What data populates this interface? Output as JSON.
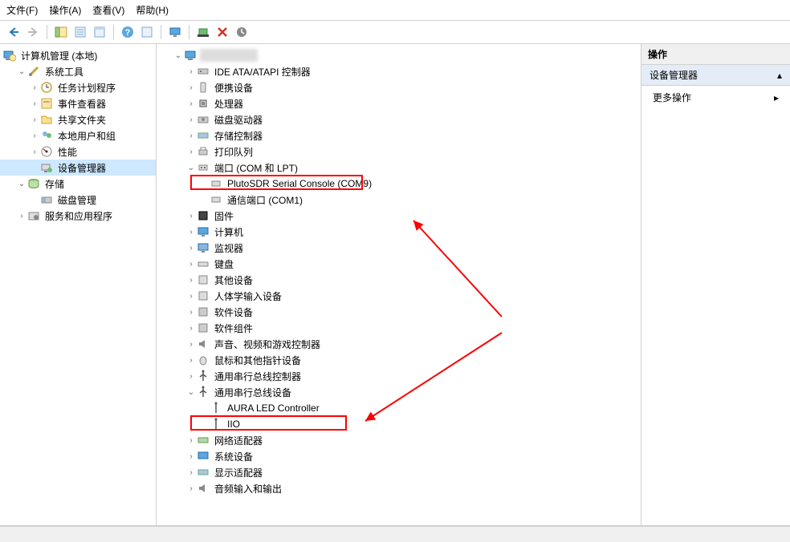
{
  "menu": {
    "file": "文件(F)",
    "action": "操作(A)",
    "view": "查看(V)",
    "help": "帮助(H)"
  },
  "left_tree": {
    "root": "计算机管理 (本地)",
    "system_tools": {
      "label": "系统工具",
      "children": {
        "task_scheduler": "任务计划程序",
        "event_viewer": "事件查看器",
        "shared_folders": "共享文件夹",
        "local_users": "本地用户和组",
        "performance": "性能",
        "device_manager": "设备管理器"
      }
    },
    "storage": {
      "label": "存储",
      "children": {
        "disk_mgmt": "磁盘管理"
      }
    },
    "services": "服务和应用程序"
  },
  "dev_tree": {
    "ide": "IDE ATA/ATAPI 控制器",
    "portable": "便携设备",
    "processors": "处理器",
    "disk_drives": "磁盘驱动器",
    "storage_ctrl": "存储控制器",
    "print_queues": "打印队列",
    "ports": {
      "label": "端口 (COM 和 LPT)",
      "children": {
        "pluto": "PlutoSDR Serial Console (COM9)",
        "com1": "通信端口 (COM1)"
      }
    },
    "firmware": "固件",
    "computer": "计算机",
    "monitors": "监视器",
    "keyboards": "键盘",
    "other": "其他设备",
    "hid": "人体学输入设备",
    "software_dev": "软件设备",
    "software_comp": "软件组件",
    "sound": "声音、视频和游戏控制器",
    "mice": "鼠标和其他指针设备",
    "usb_ctrl": "通用串行总线控制器",
    "usb_dev": {
      "label": "通用串行总线设备",
      "children": {
        "aura": "AURA LED Controller",
        "iio": "IIO"
      }
    },
    "network": "网络适配器",
    "system_devices": "系统设备",
    "display": "显示适配器",
    "audio": "音频输入和输出"
  },
  "actions": {
    "header": "操作",
    "panel_title": "设备管理器",
    "more": "更多操作"
  }
}
